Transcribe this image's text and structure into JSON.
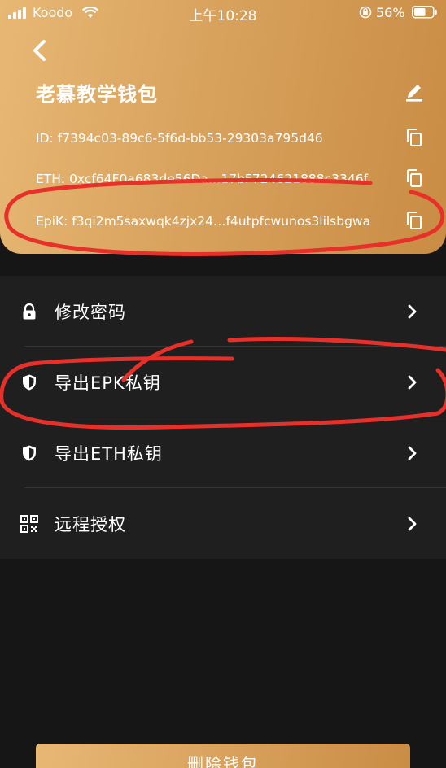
{
  "status_bar": {
    "carrier": "Koodo",
    "time": "上午10:28",
    "battery": "56%"
  },
  "wallet": {
    "title": "老慕教学钱包",
    "id_line": "ID: f7394c03-89c6-5f6d-bb53-29303a795d46",
    "eth_line": "ETH: 0xcf64F0a683de56Da…17bF724621888c3346f",
    "epik_line": "EpiK: f3qi2m5saxwqk4zjx24…f4utpfcwunos3lilsbgwa"
  },
  "menu": {
    "items": [
      {
        "label": "修改密码",
        "icon": "lock-icon"
      },
      {
        "label": "导出EPK私钥",
        "icon": "shield-icon"
      },
      {
        "label": "导出ETH私钥",
        "icon": "shield-icon"
      },
      {
        "label": "远程授权",
        "icon": "qr-code-icon"
      }
    ]
  },
  "actions": {
    "delete_label": "删除钱包"
  },
  "colors": {
    "gold_light": "#e7b874",
    "gold_dark": "#c98c44",
    "background": "#161616",
    "menu_background": "#1f1f1f",
    "annotation": "#e8302a"
  }
}
